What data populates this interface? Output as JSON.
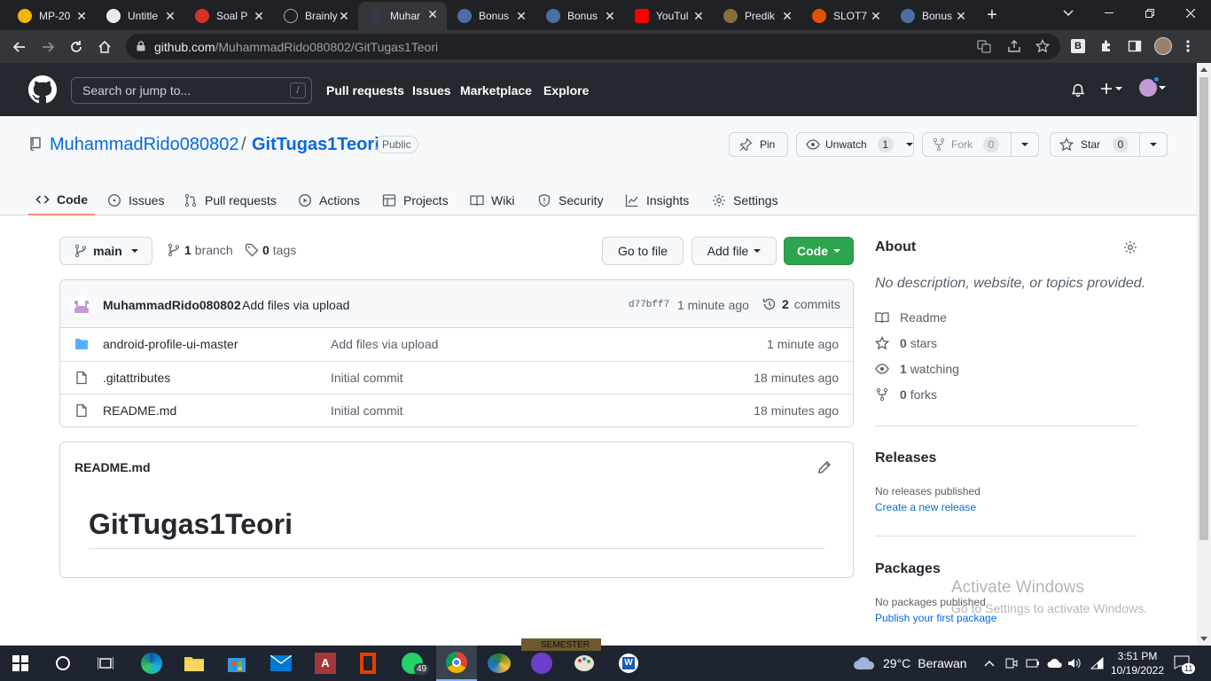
{
  "browser": {
    "tabs": [
      {
        "label": "MP-20",
        "color": "#f4b400"
      },
      {
        "label": "Untitle",
        "color": "#e8eaed"
      },
      {
        "label": "Soal P",
        "color": "#d93025"
      },
      {
        "label": "Brainly",
        "color": "#202124"
      },
      {
        "label": "Muhar",
        "color": "#333a45",
        "active": true
      },
      {
        "label": "Bonus",
        "color": "#4a6fa5"
      },
      {
        "label": "Bonus",
        "color": "#4a6fa5"
      },
      {
        "label": "YouTul",
        "color": "#ff0000"
      },
      {
        "label": "Predik",
        "color": "#8a6d3b"
      },
      {
        "label": "SLOT7",
        "color": "#e65100"
      },
      {
        "label": "Bonus",
        "color": "#4a6fa5"
      }
    ],
    "new_tab": "+",
    "url_host": "github.com",
    "url_path": "/MuhammadRido080802/GitTugas1Teori"
  },
  "gh": {
    "search_placeholder": "Search or jump to...",
    "search_shortcut": "/",
    "nav": [
      "Pull requests",
      "Issues",
      "Marketplace",
      "Explore"
    ]
  },
  "repo": {
    "owner": "MuhammadRido080802",
    "separator": "/",
    "name": "GitTugas1Teori",
    "visibility": "Public",
    "pin": "Pin",
    "unwatch": "Unwatch",
    "watch_count": "1",
    "fork": "Fork",
    "fork_count": "0",
    "star": "Star",
    "star_count": "0",
    "tabs": [
      "Code",
      "Issues",
      "Pull requests",
      "Actions",
      "Projects",
      "Wiki",
      "Security",
      "Insights",
      "Settings"
    ]
  },
  "main": {
    "branch": "main",
    "branch_count": "1",
    "branch_label": "branch",
    "tag_count": "0",
    "tag_label": "tags",
    "go_to_file": "Go to file",
    "add_file": "Add file",
    "code": "Code",
    "commit": {
      "author": "MuhammadRido080802",
      "message": "Add files via upload",
      "sha": "d77bff7",
      "time": "1 minute ago",
      "count": "2",
      "count_label": "commits"
    },
    "files": [
      {
        "type": "folder",
        "name": "android-profile-ui-master",
        "message": "Add files via upload",
        "age": "1 minute ago"
      },
      {
        "type": "file",
        "name": ".gitattributes",
        "message": "Initial commit",
        "age": "18 minutes ago"
      },
      {
        "type": "file",
        "name": "README.md",
        "message": "Initial commit",
        "age": "18 minutes ago"
      }
    ],
    "readme": {
      "header": "README.md",
      "title": "GitTugas1Teori"
    }
  },
  "sidebar": {
    "about_title": "About",
    "description": "No description, website, or topics provided.",
    "readme": "Readme",
    "stars_count": "0",
    "stars_label": "stars",
    "watching_count": "1",
    "watching_label": "watching",
    "forks_count": "0",
    "forks_label": "forks",
    "releases_title": "Releases",
    "no_releases": "No releases published",
    "create_release": "Create a new release",
    "packages_title": "Packages",
    "no_packages": "No packages published",
    "publish_package": "Publish your first package"
  },
  "watermark": {
    "line1": "Activate Windows",
    "line2": "Go to Settings to activate Windows."
  },
  "taskbar": {
    "whatsapp_badge": "49",
    "temperature": "29°C",
    "weather": "Berawan",
    "time": "3:51 PM",
    "date": "10/19/2022",
    "notifications": "11",
    "ghost_label": "SEMESTER"
  }
}
